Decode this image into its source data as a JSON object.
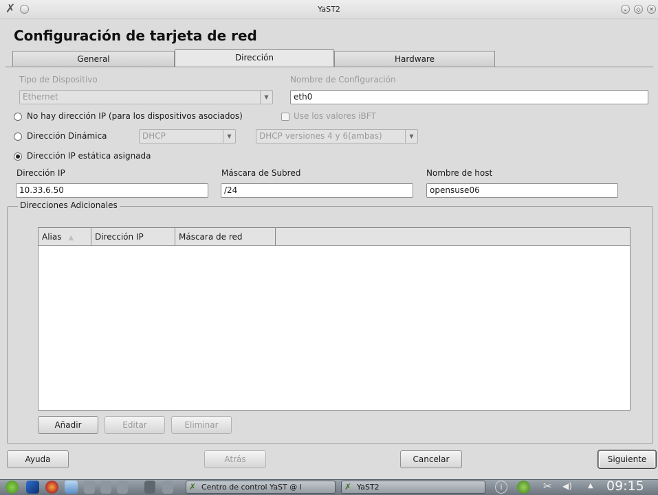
{
  "window": {
    "title": "YaST2"
  },
  "page": {
    "heading": "Configuración de tarjeta de red"
  },
  "tabs": [
    {
      "label": "General",
      "active": false
    },
    {
      "label": "Dirección",
      "active": true
    },
    {
      "label": "Hardware",
      "active": false
    }
  ],
  "device": {
    "type_label": "Tipo de Dispositivo",
    "type_value": "Ethernet",
    "config_name_label": "Nombre de Configuración",
    "config_name_value": "eth0"
  },
  "address_modes": {
    "no_ip_label": "No hay dirección IP (para los dispositivos asociados)",
    "ibft_label": "Use los valores iBFT",
    "dynamic_label": "Dirección Dinámica",
    "dynamic_method": "DHCP",
    "dhcp_version": "DHCP versiones 4 y 6(ambas)",
    "static_label": "Dirección IP estática asignada",
    "selected": "static"
  },
  "static": {
    "ip_label": "Dirección IP",
    "ip_value": "10.33.6.50",
    "mask_label": "Máscara de Subred",
    "mask_value": "/24",
    "hostname_label": "Nombre de host",
    "hostname_value": "opensuse06"
  },
  "additional": {
    "legend": "Direcciones Adicionales",
    "columns": [
      "Alias",
      "Dirección IP",
      "Máscara de red"
    ],
    "rows": [],
    "add_label": "Añadir",
    "edit_label": "Editar",
    "delete_label": "Eliminar"
  },
  "footer": {
    "help": "Ayuda",
    "back": "Atrás",
    "cancel": "Cancelar",
    "next": "Siguiente"
  },
  "taskbar": {
    "tasks": [
      "Centro de control YaST @ l",
      "YaST2"
    ],
    "clock": "09:15"
  }
}
